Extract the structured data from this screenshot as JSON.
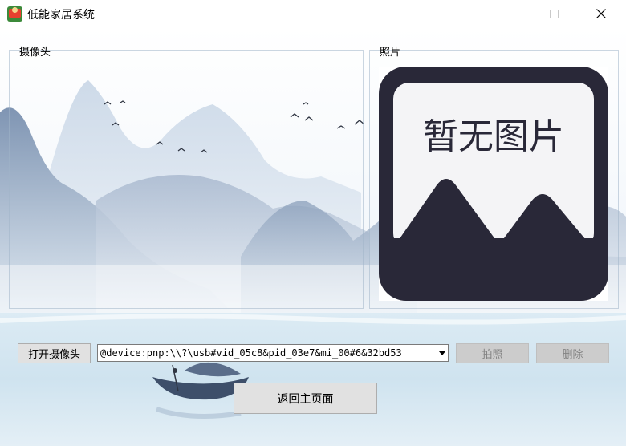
{
  "window": {
    "title": "低能家居系统",
    "icons": {
      "app": "app-icon",
      "minimize": "minimize-icon",
      "maximize": "maximize-icon",
      "close": "close-icon"
    }
  },
  "camera_group": {
    "title": "摄像头"
  },
  "photo_group": {
    "title": "照片",
    "placeholder_text": "暂无图片",
    "placeholder_icon": "no-image-icon"
  },
  "controls": {
    "open_camera_label": "打开摄像头",
    "device_selected": "@device:pnp:\\\\?\\usb#vid_05c8&pid_03e7&mi_00#6&32bd53",
    "capture_label": "拍照",
    "delete_label": "删除",
    "home_label": "返回主页面"
  },
  "colors": {
    "placeholder_dark": "#292838",
    "placeholder_light": "#f4f4f6"
  }
}
